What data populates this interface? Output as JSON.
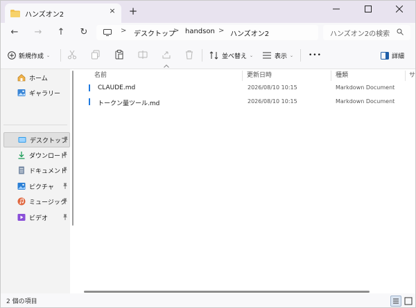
{
  "window": {
    "tab_title": "ハンズオン2",
    "close_tab_glyph": "×",
    "new_tab_glyph": "+"
  },
  "controls": {
    "minimize": "—",
    "maximize": "□",
    "close": "✕"
  },
  "nav": {
    "back": "←",
    "forward": "→",
    "up": "↑",
    "refresh": "↻"
  },
  "breadcrumb": {
    "separator": ">",
    "items": [
      "デスクトップ",
      "handson",
      "ハンズオン2"
    ]
  },
  "search": {
    "placeholder": "ハンズオン2の検索"
  },
  "toolbar": {
    "new_label": "新規作成",
    "sort_label": "並べ替え",
    "view_label": "表示",
    "more_label": "•••",
    "details_label": "詳細",
    "caret": "⌄"
  },
  "sidebar": {
    "items": [
      {
        "label": "ホーム",
        "icon": "home-icon"
      },
      {
        "label": "ギャラリー",
        "icon": "gallery-icon"
      },
      {
        "label": "デスクトップ",
        "icon": "desktop-folder-icon",
        "pinned": true,
        "selected": true
      },
      {
        "label": "ダウンロード",
        "icon": "download-icon",
        "pinned": true
      },
      {
        "label": "ドキュメント",
        "icon": "document-icon",
        "pinned": true
      },
      {
        "label": "ピクチャ",
        "icon": "pictures-icon",
        "pinned": true
      },
      {
        "label": "ミュージック",
        "icon": "music-icon",
        "pinned": true
      },
      {
        "label": "ビデオ",
        "icon": "video-icon",
        "pinned": true
      }
    ],
    "pin_glyph": "📌"
  },
  "columns": {
    "name": "名前",
    "modified": "更新日時",
    "type": "種類",
    "size": "サ"
  },
  "files": [
    {
      "name": "CLAUDE.md",
      "modified": "2026/08/10 10:15",
      "type": "Markdown Document"
    },
    {
      "name": "トークン量ツール.md",
      "modified": "2026/08/10 10:15",
      "type": "Markdown Document"
    }
  ],
  "status": {
    "item_count": "2 個の項目"
  },
  "colors": {
    "accent": "#1f7ae0",
    "titlebar": "#e8e3ef",
    "folder": "#f2c14e"
  }
}
